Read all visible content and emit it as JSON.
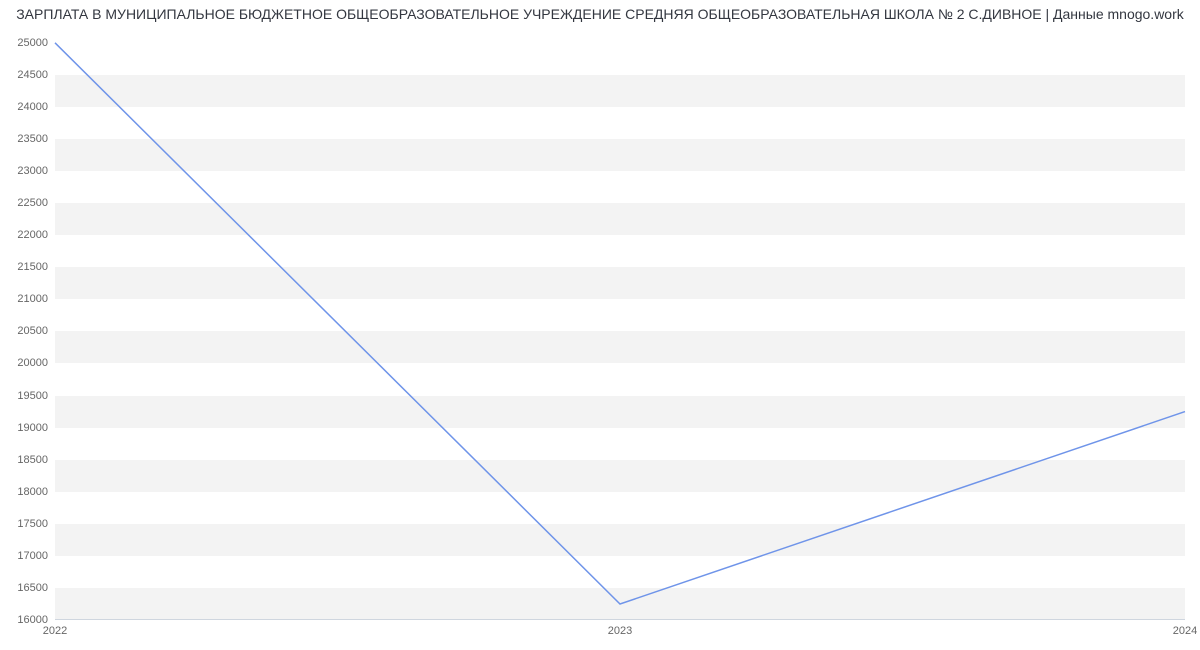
{
  "chart_data": {
    "type": "line",
    "title": "ЗАРПЛАТА В МУНИЦИПАЛЬНОЕ БЮДЖЕТНОЕ ОБЩЕОБРАЗОВАТЕЛЬНОЕ УЧРЕЖДЕНИЕ СРЕДНЯЯ ОБЩЕОБРАЗОВАТЕЛЬНАЯ ШКОЛА № 2 С.ДИВНОЕ | Данные mnogo.work",
    "xlabel": "",
    "ylabel": "",
    "x": [
      2022,
      2023,
      2024
    ],
    "values": [
      25000,
      16250,
      19250
    ],
    "x_ticks": [
      2022,
      2023,
      2024
    ],
    "y_ticks": [
      16000,
      16500,
      17000,
      17500,
      18000,
      18500,
      19000,
      19500,
      20000,
      20500,
      21000,
      21500,
      22000,
      22500,
      23000,
      23500,
      24000,
      24500,
      25000
    ],
    "xlim": [
      2022,
      2024
    ],
    "ylim": [
      16000,
      25200
    ],
    "grid": true,
    "line_color": "#6f94e9"
  }
}
